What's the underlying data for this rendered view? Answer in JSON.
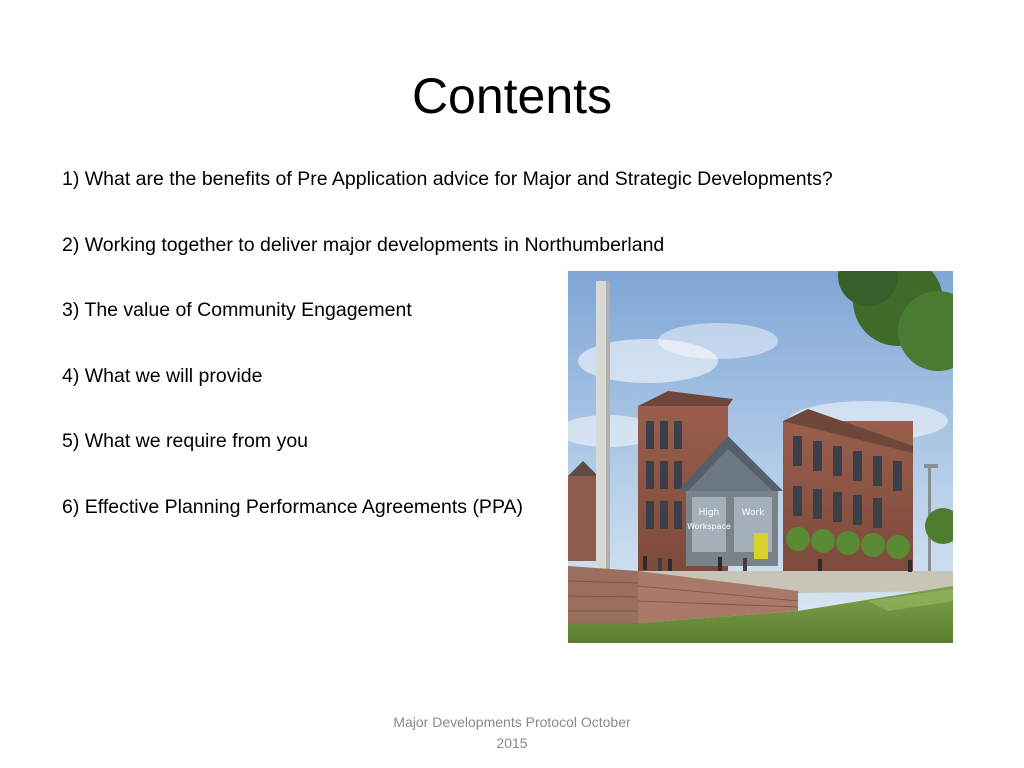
{
  "slide": {
    "title": "Contents",
    "items": [
      "1) What are the benefits of Pre Application advice for Major and Strategic Developments?",
      "2) Working together to deliver major developments in Northumberland",
      "3) The value of Community Engagement",
      "4) What we will provide",
      "5) What we require from you",
      "6) Effective Planning Performance Agreements (PPA)"
    ],
    "photo": {
      "sign_text": "Workspace",
      "sign_text_left": "High",
      "sign_text_right": "Work"
    },
    "footer": {
      "line1": "Major Developments Protocol October",
      "line2": "2015"
    }
  }
}
